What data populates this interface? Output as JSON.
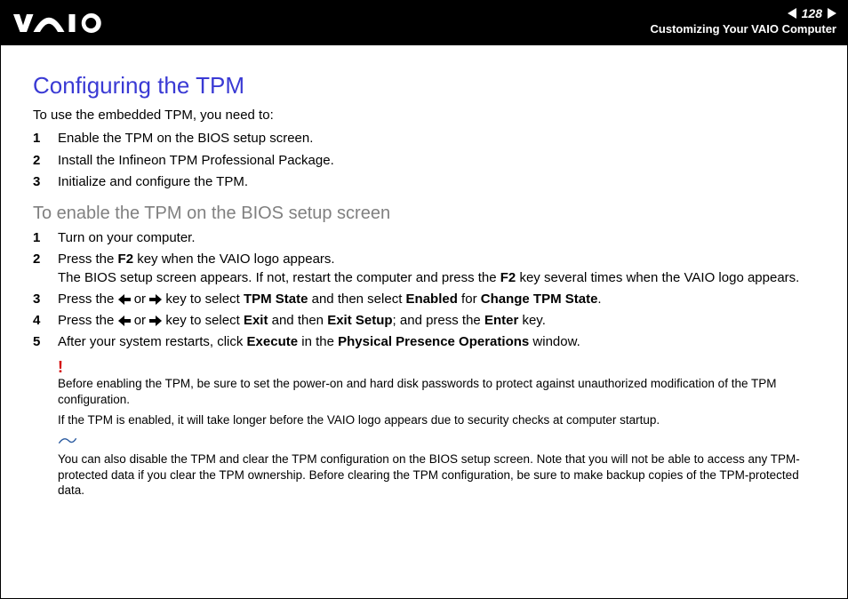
{
  "header": {
    "page_number": "128",
    "section": "Customizing Your VAIO Computer"
  },
  "title": "Configuring the TPM",
  "intro": "To use the embedded TPM, you need to:",
  "steps1": [
    "Enable the TPM on the BIOS setup screen.",
    "Install the Infineon TPM Professional Package.",
    "Initialize and configure the TPM."
  ],
  "subtitle": "To enable the TPM on the BIOS setup screen",
  "steps2": {
    "s1": "Turn on your computer.",
    "s2_a": "Press the ",
    "s2_b": "F2",
    "s2_c": " key when the VAIO logo appears.",
    "s2_d": "The BIOS setup screen appears. If not, restart the computer and press the ",
    "s2_e": "F2",
    "s2_f": " key several times when the VAIO logo appears.",
    "s3_a": "Press the ",
    "s3_b": " or ",
    "s3_c": " key to select ",
    "s3_d": "TPM State",
    "s3_e": " and then select ",
    "s3_f": "Enabled",
    "s3_g": " for ",
    "s3_h": "Change TPM State",
    "s3_i": ".",
    "s4_a": "Press the ",
    "s4_b": " or ",
    "s4_c": " key to select ",
    "s4_d": "Exit",
    "s4_e": " and then ",
    "s4_f": "Exit Setup",
    "s4_g": "; and press the ",
    "s4_h": "Enter",
    "s4_i": " key.",
    "s5_a": "After your system restarts, click ",
    "s5_b": "Execute",
    "s5_c": " in the ",
    "s5_d": "Physical Presence Operations",
    "s5_e": " window."
  },
  "warn1": "Before enabling the TPM, be sure to set the power-on and hard disk passwords to protect against unauthorized modification of the TPM configuration.",
  "warn2": "If the TPM is enabled, it will take longer before the VAIO logo appears due to security checks at computer startup.",
  "tip": "You can also disable the TPM and clear the TPM configuration on the BIOS setup screen. Note that you will not be able to access any TPM-protected data if you clear the TPM ownership. Before clearing the TPM configuration, be sure to make backup copies of the TPM-protected data."
}
